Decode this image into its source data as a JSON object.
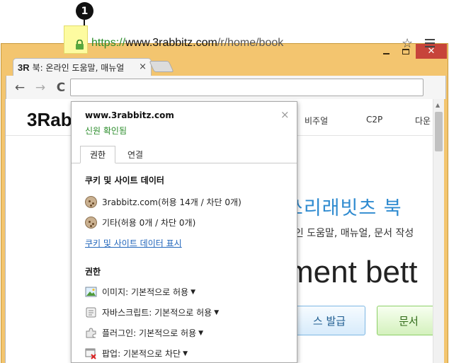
{
  "callout": {
    "number": "1"
  },
  "tab": {
    "logo": "3R",
    "title": "북: 온라인 도움말, 매뉴얼",
    "close": "×"
  },
  "toolbar": {
    "back": "←",
    "forward": "→",
    "reload": "C",
    "url_scheme": "https://",
    "url_host": "www.3rabbitz.com",
    "url_path": "/r/home/book",
    "star": "☆"
  },
  "page": {
    "logo": "3Rab",
    "nav": [
      "비주얼",
      "C2P",
      "다운"
    ],
    "hero_title": "쓰리래빗츠 북",
    "hero_subtitle": "라인 도움말, 매뉴얼, 문서 작성",
    "hero_big": "ment bett",
    "btn_blue": "스 발급",
    "btn_green": "문서"
  },
  "popup": {
    "site": "www.3rabbitz.com",
    "verified": "신원 확인됨",
    "close": "×",
    "tabs": [
      "권한",
      "연결"
    ],
    "cookie_section_title": "쿠키 및 사이트 데이터",
    "cookie_rows": [
      "3rabbitz.com(허용 14개 / 차단 0개)",
      "기타(허용 0개 / 차단 0개)"
    ],
    "cookie_link": "쿠키 및 사이트 데이터 표시",
    "perm_section_title": "권한",
    "permissions": [
      {
        "icon": "image-icon",
        "label": "이미지:",
        "value": "기본적으로 허용"
      },
      {
        "icon": "script-icon",
        "label": "자바스크립트:",
        "value": "기본적으로 허용"
      },
      {
        "icon": "plugin-icon",
        "label": "플러그인:",
        "value": "기본적으로 허용"
      },
      {
        "icon": "popup-blocked-icon",
        "label": "팝업:",
        "value": "기본적으로 차단"
      }
    ]
  },
  "colors": {
    "frame": "#f3c56f",
    "close_button": "#c7443a",
    "secure_green": "#2a8c2a",
    "link_blue": "#2266bb",
    "hero_blue": "#2f8bd0"
  }
}
